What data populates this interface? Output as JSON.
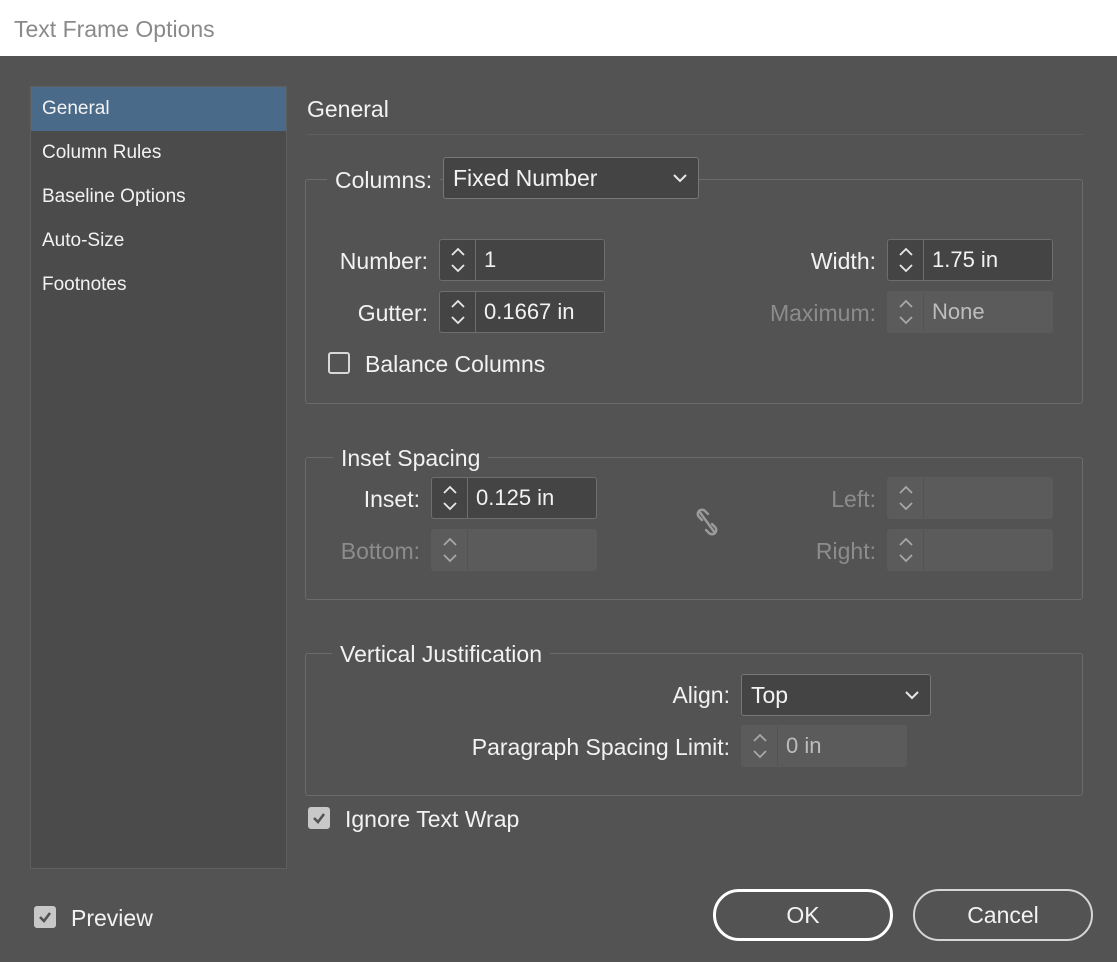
{
  "window": {
    "title": "Text Frame Options"
  },
  "sidebar": {
    "items": [
      {
        "label": "General",
        "active": true
      },
      {
        "label": "Column Rules"
      },
      {
        "label": "Baseline Options"
      },
      {
        "label": "Auto-Size"
      },
      {
        "label": "Footnotes"
      }
    ]
  },
  "section": {
    "title": "General"
  },
  "columns": {
    "legend": "Columns:",
    "type": "Fixed Number",
    "number_label": "Number:",
    "number_value": "1",
    "gutter_label": "Gutter:",
    "gutter_value": "0.1667 in",
    "width_label": "Width:",
    "width_value": "1.75 in",
    "maximum_label": "Maximum:",
    "maximum_value": "None",
    "balance_label": "Balance Columns",
    "balance_checked": false
  },
  "inset": {
    "legend": "Inset Spacing",
    "inset_label": "Inset:",
    "inset_value": "0.125 in",
    "bottom_label": "Bottom:",
    "bottom_value": "",
    "left_label": "Left:",
    "left_value": "",
    "right_label": "Right:",
    "right_value": ""
  },
  "vertical": {
    "legend": "Vertical Justification",
    "align_label": "Align:",
    "align_value": "Top",
    "psl_label": "Paragraph Spacing Limit:",
    "psl_value": "0 in"
  },
  "ignore_wrap": {
    "label": "Ignore Text Wrap",
    "checked": true
  },
  "preview": {
    "label": "Preview",
    "checked": true
  },
  "buttons": {
    "ok": "OK",
    "cancel": "Cancel"
  },
  "colors": {
    "background": "#535353",
    "selection": "#4a6a8a",
    "panel": "#4b4b4b"
  },
  "icons": {
    "spinner": "up-down-chevron-icon",
    "dropdown": "chevron-down-icon",
    "link": "broken-chain-link-icon",
    "check": "checkmark-icon"
  }
}
